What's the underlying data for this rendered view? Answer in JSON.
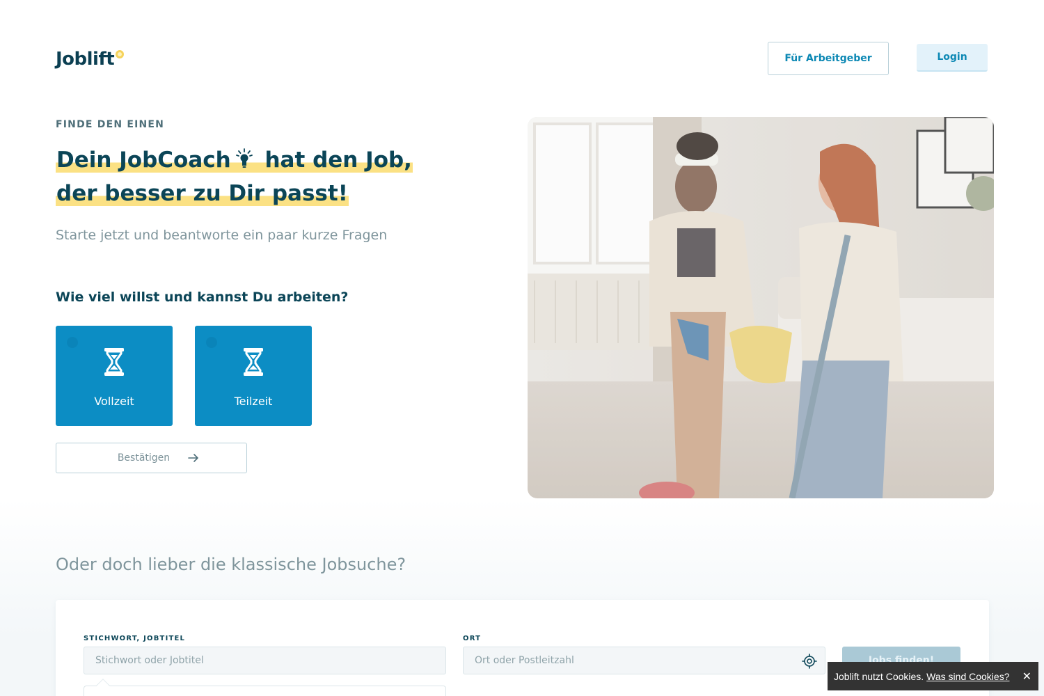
{
  "header": {
    "logo_text": "Joblift",
    "employer_button": "Für Arbeitgeber",
    "login_button": "Login"
  },
  "hero": {
    "eyebrow": "FINDE DEN EINEN",
    "headline_part1": "Dein JobCoach",
    "headline_part2": "hat den Job,",
    "headline_line2": "der besser zu Dir passt!",
    "subline": "Starte jetzt und beantworte ein paar kurze Fragen",
    "question": "Wie viel willst und kannst Du arbeiten?",
    "options": [
      {
        "label": "Vollzeit",
        "icon": "hourglass-icon"
      },
      {
        "label": "Teilzeit",
        "icon": "hourglass-icon"
      }
    ],
    "confirm_button": "Bestätigen",
    "confirm_icon": "arrow-right-icon"
  },
  "search": {
    "heading": "Oder doch lieber die klassische Jobsuche?",
    "keyword_label": "STICHWORT, JOBTITEL",
    "keyword_placeholder": "Stichwort oder Jobtitel",
    "location_label": "ORT",
    "location_placeholder": "Ort oder Postleitzahl",
    "location_icon": "crosshair-icon",
    "submit_button": "Jobs finden!"
  },
  "cookie": {
    "text": "Joblift nutzt Cookies.",
    "link": "Was sind Cookies?",
    "close": "✕"
  },
  "colors": {
    "primary": "#0c8dc4",
    "brand_dark": "#0b4557",
    "highlight": "#fbe184",
    "muted": "#7f959c"
  }
}
